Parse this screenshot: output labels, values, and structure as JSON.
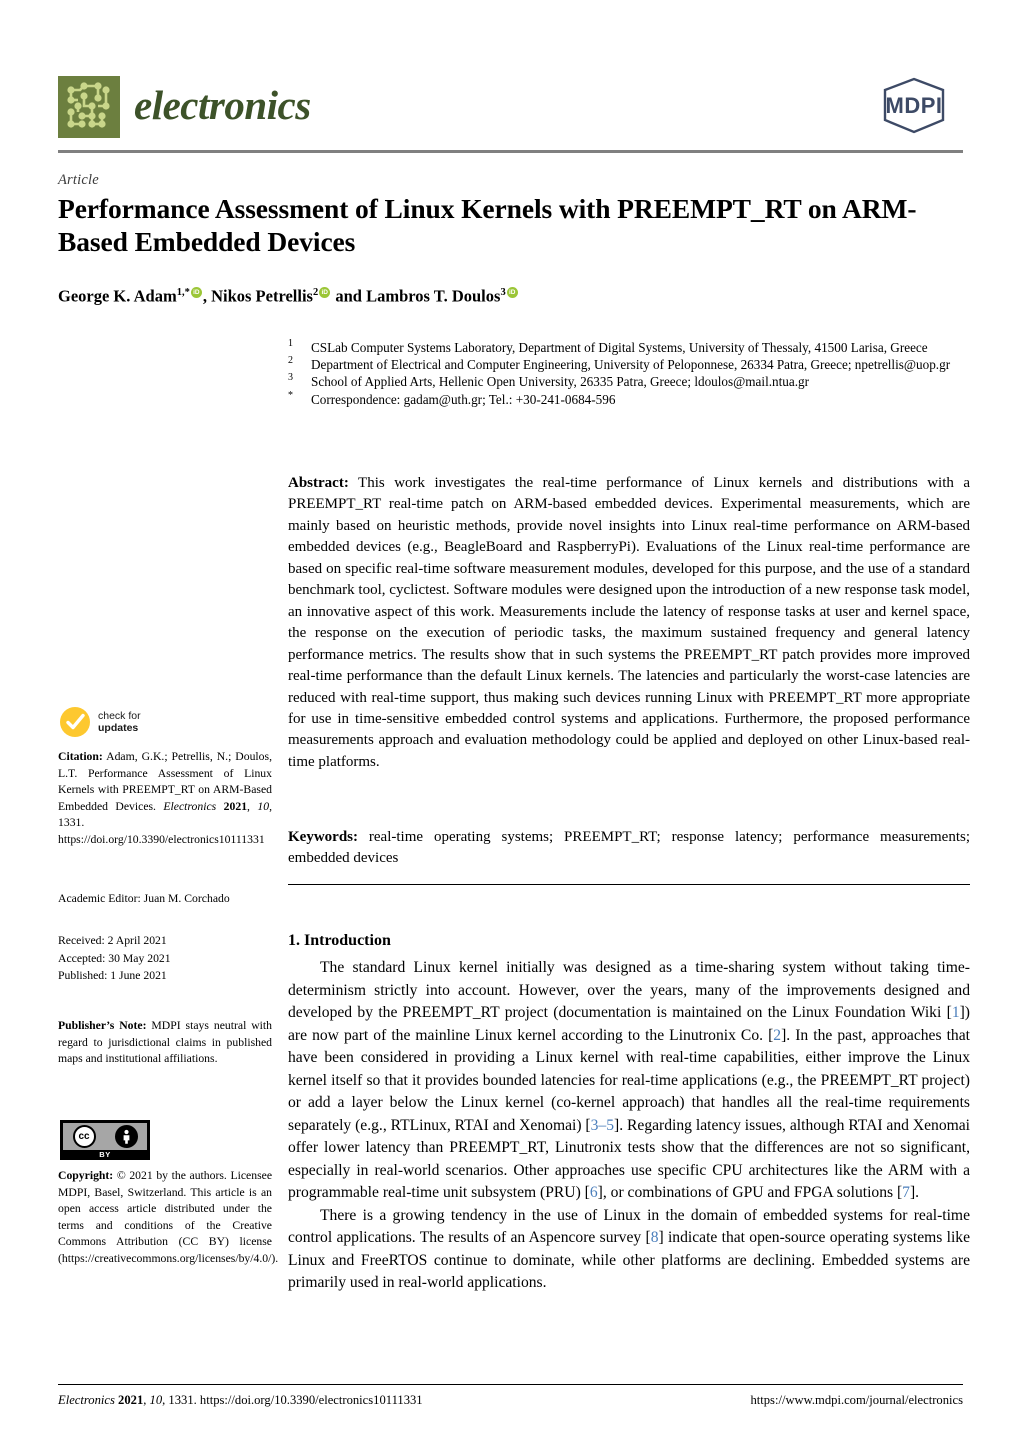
{
  "journal": {
    "name": "electronics",
    "publisher_logo_text": "MDPI"
  },
  "article": {
    "type": "Article",
    "title": "Performance Assessment of Linux Kernels with PREEMPT_RT on ARM-Based Embedded Devices",
    "authors_html": "George K. Adam <sup>1,*</sup><orcid>, Nikos Petrellis <sup>2</sup><orcid> and Lambros T. Doulos <sup>3</sup><orcid>",
    "authors_plain": "George K. Adam 1,*, Nikos Petrellis 2 and Lambros T. Doulos 3"
  },
  "affiliations": [
    {
      "mark": "1",
      "text": "CSLab Computer Systems Laboratory, Department of Digital Systems, University of Thessaly, 41500 Larisa, Greece"
    },
    {
      "mark": "2",
      "text": "Department of Electrical and Computer Engineering, University of Peloponnese, 26334 Patra, Greece; npetrellis@uop.gr"
    },
    {
      "mark": "3",
      "text": "School of Applied Arts, Hellenic Open University, 26335 Patra, Greece; ldoulos@mail.ntua.gr"
    },
    {
      "mark": "*",
      "text": "Correspondence: gadam@uth.gr; Tel.: +30-241-0684-596"
    }
  ],
  "abstract": {
    "label": "Abstract:",
    "text": "This work investigates the real-time performance of Linux kernels and distributions with a PREEMPT_RT real-time patch on ARM-based embedded devices. Experimental measurements, which are mainly based on heuristic methods, provide novel insights into Linux real-time performance on ARM-based embedded devices (e.g., BeagleBoard and RaspberryPi). Evaluations of the Linux real-time performance are based on specific real-time software measurement modules, developed for this purpose, and the use of a standard benchmark tool, cyclictest. Software modules were designed upon the introduction of a new response task model, an innovative aspect of this work. Measurements include the latency of response tasks at user and kernel space, the response on the execution of periodic tasks, the maximum sustained frequency and general latency performance metrics. The results show that in such systems the PREEMPT_RT patch provides more improved real-time performance than the default Linux kernels. The latencies and particularly the worst-case latencies are reduced with real-time support, thus making such devices running Linux with PREEMPT_RT more appropriate for use in time-sensitive embedded control systems and applications. Furthermore, the proposed performance measurements approach and evaluation methodology could be applied and deployed on other Linux-based real-time platforms."
  },
  "keywords": {
    "label": "Keywords:",
    "text": "real-time operating systems; PREEMPT_RT; response latency; performance measurements; embedded devices"
  },
  "section": {
    "heading": "1. Introduction",
    "paragraph1_pre": "The standard Linux kernel initially was designed as a time-sharing system without taking time-determinism strictly into account. However, over the years, many of the improvements designed and developed by the PREEMPT_RT project (documentation is maintained on the Linux Foundation Wiki [",
    "p1_ref1": "1",
    "p1_mid1": "]) are now part of the mainline Linux kernel according to the Linutronix Co. [",
    "p1_ref2": "2",
    "p1_mid2": "]. In the past, approaches that have been considered in providing a Linux kernel with real-time capabilities, either improve the Linux kernel itself so that it provides bounded latencies for real-time applications (e.g., the PREEMPT_RT project) or add a layer below the Linux kernel (co-kernel approach) that handles all the real-time requirements separately (e.g., RTLinux, RTAI and Xenomai) [",
    "p1_ref3": "3–5",
    "p1_mid3": "]. Regarding latency issues, although RTAI and Xenomai offer lower latency than PREEMPT_RT, Linutronix tests show that the differences are not so significant, especially in real-world scenarios. Other approaches use specific CPU architectures like the ARM with a programmable real-time unit subsystem (PRU) [",
    "p1_ref4": "6",
    "p1_mid4": "], or combinations of GPU and FPGA solutions [",
    "p1_ref5": "7",
    "p1_end": "].",
    "paragraph2_pre": "There is a growing tendency in the use of Linux in the domain of embedded systems for real-time control applications. The results of an Aspencore survey [",
    "p2_ref1": "8",
    "p2_post": "] indicate that open-source operating systems like Linux and FreeRTOS continue to dominate, while other platforms are declining. Embedded systems are primarily used in real-world applications."
  },
  "sidebar": {
    "check_for_updates": {
      "line1": "check for",
      "line2": "updates"
    },
    "citation": {
      "label": "Citation:",
      "body_a": "Adam, G.K.; Petrellis, N.; Doulos, L.T. Performance Assessment of Linux Kernels with PREEMPT_RT on ARM-Based Embedded Devices. ",
      "journal_italic": "Electronics",
      "year_bold": "2021",
      "volume_italic": "10",
      "pages": ", 1331. ",
      "doi": "https://doi.org/10.3390/electronics10111331"
    },
    "academic_editor": "Academic Editor: Juan M. Corchado",
    "dates": [
      "Received: 2 April 2021",
      "Accepted: 30 May 2021",
      "Published: 1 June 2021"
    ],
    "publishers_note": {
      "label": "Publisher’s Note:",
      "text": "MDPI stays neutral with regard to jurisdictional claims in published maps and institutional affiliations."
    },
    "license_badge": {
      "cc": "cc",
      "by": "BY"
    },
    "copyright": {
      "label": "Copyright:",
      "text": "© 2021 by the authors. Licensee MDPI, Basel, Switzerland. This article is an open access article distributed under the terms and conditions of the Creative Commons Attribution (CC BY) license (https://creativecommons.org/licenses/by/4.0/)."
    }
  },
  "footer": {
    "left_journal": "Electronics",
    "left_year": "2021",
    "left_volume": "10",
    "left_rest": ", 1331. https://doi.org/10.3390/electronics10111331",
    "right": "https://www.mdpi.com/journal/electronics"
  },
  "colors": {
    "logo_green": "#6c7f3f",
    "logo_word_green": "#3d5229",
    "mdpi_navy": "#3d4a66",
    "orcid_green": "#9bc637",
    "check_yellow": "#fdc82f",
    "citation_link_blue": "#4a7ebb",
    "rule_gray": "#808080"
  }
}
